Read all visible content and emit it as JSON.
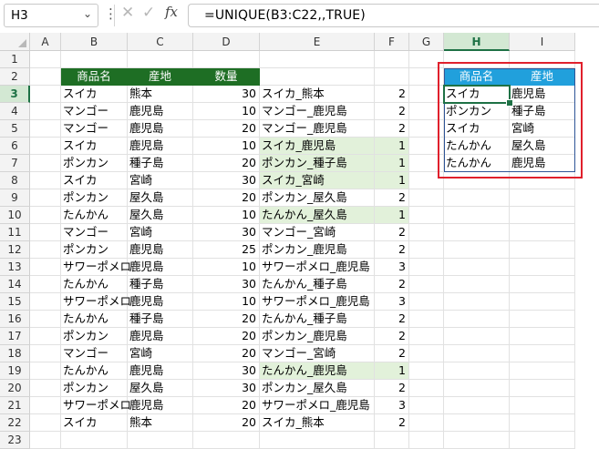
{
  "name_box": "H3",
  "formula": "=UNIQUE(B3:C22,,TRUE)",
  "formula_icons": {
    "cancel": "✕",
    "confirm": "✓",
    "function": "fx"
  },
  "columns": [
    "A",
    "B",
    "C",
    "D",
    "E",
    "F",
    "G",
    "H",
    "I"
  ],
  "rows": [
    "1",
    "2",
    "3",
    "4",
    "5",
    "6",
    "7",
    "8",
    "9",
    "10",
    "11",
    "12",
    "13",
    "14",
    "15",
    "16",
    "17",
    "18",
    "19",
    "20",
    "21",
    "22",
    "23"
  ],
  "selected_cell": "H3",
  "colors": {
    "header_green": "#1e6e24",
    "header_blue": "#21a0dc",
    "highlight": "#e2f1da",
    "red_box": "#e0202c",
    "select": "#1e7145"
  },
  "table": {
    "headers": [
      "商品名",
      "産地",
      "数量"
    ],
    "rows": [
      [
        "スイカ",
        "熊本",
        "30",
        "スイカ_熊本",
        "2"
      ],
      [
        "マンゴー",
        "鹿児島",
        "10",
        "マンゴー_鹿児島",
        "2"
      ],
      [
        "マンゴー",
        "鹿児島",
        "20",
        "マンゴー_鹿児島",
        "2"
      ],
      [
        "スイカ",
        "鹿児島",
        "10",
        "スイカ_鹿児島",
        "1"
      ],
      [
        "ポンカン",
        "種子島",
        "20",
        "ポンカン_種子島",
        "1"
      ],
      [
        "スイカ",
        "宮崎",
        "30",
        "スイカ_宮崎",
        "1"
      ],
      [
        "ポンカン",
        "屋久島",
        "20",
        "ポンカン_屋久島",
        "2"
      ],
      [
        "たんかん",
        "屋久島",
        "10",
        "たんかん_屋久島",
        "1"
      ],
      [
        "マンゴー",
        "宮崎",
        "30",
        "マンゴー_宮崎",
        "2"
      ],
      [
        "ポンカン",
        "鹿児島",
        "25",
        "ポンカン_鹿児島",
        "2"
      ],
      [
        "サワーポメロ",
        "鹿児島",
        "10",
        "サワーポメロ_鹿児島",
        "3"
      ],
      [
        "たんかん",
        "種子島",
        "30",
        "たんかん_種子島",
        "2"
      ],
      [
        "サワーポメロ",
        "鹿児島",
        "10",
        "サワーポメロ_鹿児島",
        "3"
      ],
      [
        "たんかん",
        "種子島",
        "20",
        "たんかん_種子島",
        "2"
      ],
      [
        "ポンカン",
        "鹿児島",
        "20",
        "ポンカン_鹿児島",
        "2"
      ],
      [
        "マンゴー",
        "宮崎",
        "20",
        "マンゴー_宮崎",
        "2"
      ],
      [
        "たんかん",
        "鹿児島",
        "30",
        "たんかん_鹿児島",
        "1"
      ],
      [
        "ポンカン",
        "屋久島",
        "30",
        "ポンカン_屋久島",
        "2"
      ],
      [
        "サワーポメロ",
        "鹿児島",
        "20",
        "サワーポメロ_鹿児島",
        "3"
      ],
      [
        "スイカ",
        "熊本",
        "20",
        "スイカ_熊本",
        "2"
      ]
    ],
    "highlighted_rows": [
      6,
      7,
      8,
      10,
      19
    ]
  },
  "result": {
    "headers": [
      "商品名",
      "産地"
    ],
    "rows": [
      [
        "スイカ",
        "鹿児島"
      ],
      [
        "ポンカン",
        "種子島"
      ],
      [
        "スイカ",
        "宮崎"
      ],
      [
        "たんかん",
        "屋久島"
      ],
      [
        "たんかん",
        "鹿児島"
      ]
    ]
  }
}
